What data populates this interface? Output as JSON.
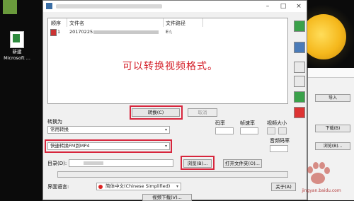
{
  "desktop": {
    "icon_label": "新建\nMicrosoft ..."
  },
  "window": {
    "title_minimize": "–",
    "title_maximize": "□",
    "title_close": "×"
  },
  "list": {
    "col_index": "顺序",
    "col_filename": "文件名",
    "col_location": "文件路径",
    "row_index": "1",
    "row_filename": "20170225",
    "row_path": "E:\\",
    "overlay": "可以转换视频格式。"
  },
  "toolbar": {
    "convert_label": "转换(C)",
    "cancel_label": "取消"
  },
  "settings": {
    "convert_to_label": "转换为",
    "convert_to_value": "常用转换",
    "preset_value": "快速转换FM到MP4",
    "bitrate_label": "码率",
    "framerate_label": "帧速率",
    "video_size_label": "视频大小",
    "audio_bitrate_label": "音频码率",
    "dir_label": "目录(D):",
    "browse_label": "浏览(B)...",
    "open_folder_label": "打开文件夹(O)...",
    "ui_lang_label": "界面语言:",
    "ui_lang_value": "简体中文(Chinese Simplified)",
    "about_label": "关于(A)",
    "extra_button_label": "视频下载(V)..."
  },
  "side_window": {
    "btn_import": "导入",
    "btn_download": "下载(B)",
    "btn_browse": "浏览(B)..."
  },
  "watermark": {
    "text": "jingyan.baidu.com"
  }
}
